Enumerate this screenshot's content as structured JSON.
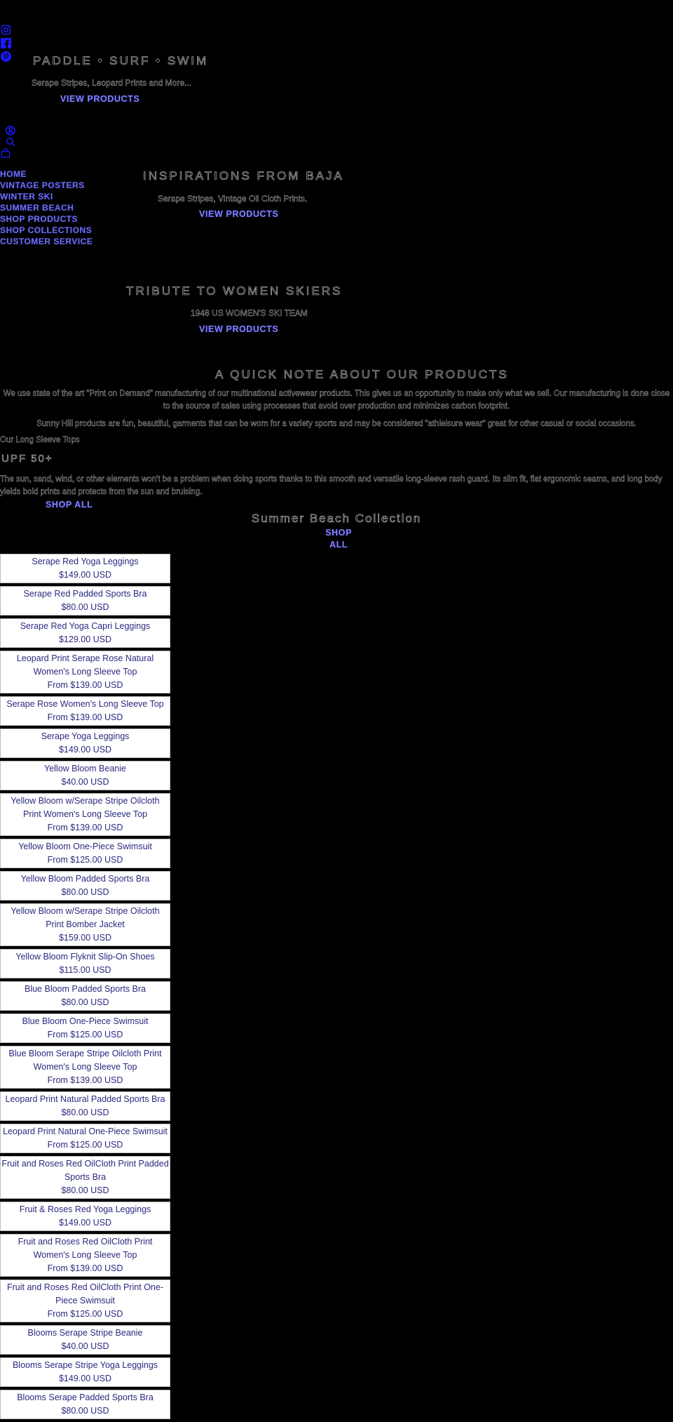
{
  "social": [
    {
      "name": "instagram-icon"
    },
    {
      "name": "facebook-icon"
    },
    {
      "name": "pinterest-icon"
    }
  ],
  "hero": [
    {
      "title": "PADDLE • SURF • SWIM",
      "subtitle": "Serape Stripes, Leopard Prints and More...",
      "cta": "VIEW PRODUCTS"
    },
    {
      "title": "INSPIRATIONS FROM BAJA",
      "subtitle": "Serape Stripes, Vintage Oil Cloth Prints.",
      "cta": "VIEW PRODUCTS"
    },
    {
      "title": "TRIBUTE TO WOMEN SKIERS",
      "subtitle": "1948 US WOMEN'S SKI TEAM",
      "cta": "VIEW PRODUCTS"
    }
  ],
  "header_icons": [
    {
      "name": "account-icon"
    },
    {
      "name": "search-icon"
    },
    {
      "name": "cart-icon"
    }
  ],
  "nav": [
    "HOME",
    "VINTAGE POSTERS",
    "WINTER SKI",
    "SUMMER BEACH",
    "SHOP PRODUCTS",
    "SHOP COLLECTIONS",
    "CUSTOMER SERVICE"
  ],
  "about": {
    "heading": "A QUICK NOTE ABOUT OUR PRODUCTS",
    "p1": "We use state of the art \"Print on Demand\" manufacturing of our multinational activewear products. This gives us an opportunity to make only what we sell. Our manufacturing is done close to the source of sales using processes that avoid over production and minimizes carbon footprint.",
    "p2": "Sunny Hill products are fun, beautiful, garments that can be worn for a variety sports and may be considered \"athleisure wear\" great for other casual or social occasions."
  },
  "featured": {
    "label": "Our Long Sleeve Tops",
    "heading": "UPF 50+",
    "body": "The sun, sand, wind, or other elements won't be a problem when doing sports thanks to this smooth and versatile long-sleeve rash guard. Its slim fit, flat ergonomic seams, and long body yields bold prints and protects from the sun and bruising.",
    "cta": "SHOP ALL"
  },
  "collection": {
    "title": "Summer Beach Collection",
    "cta_line1": "SHOP",
    "cta_line2": "ALL"
  },
  "products": [
    {
      "title": "Serape Red Yoga Leggings",
      "price": "$149.00 USD"
    },
    {
      "title": "Serape Red Padded Sports Bra",
      "price": "$80.00 USD"
    },
    {
      "title": "Serape Red Yoga Capri Leggings",
      "price": "$129.00 USD"
    },
    {
      "title": "Leopard Print Serape Rose Natural Women's Long Sleeve Top",
      "price": "From $139.00 USD"
    },
    {
      "title": "Serape Rose Women's Long Sleeve Top",
      "price": "From $139.00 USD"
    },
    {
      "title": "Serape Yoga Leggings",
      "price": "$149.00 USD"
    },
    {
      "title": "Yellow Bloom Beanie",
      "price": "$40.00 USD"
    },
    {
      "title": "Yellow Bloom w/Serape Stripe Oilcloth Print Women's Long Sleeve Top",
      "price": "From $139.00 USD"
    },
    {
      "title": "Yellow Bloom One-Piece Swimsuit",
      "price": "From $125.00 USD"
    },
    {
      "title": "Yellow Bloom Padded Sports Bra",
      "price": "$80.00 USD"
    },
    {
      "title": "Yellow Bloom w/Serape Stripe Oilcloth Print Bomber Jacket",
      "price": "$159.00 USD"
    },
    {
      "title": "Yellow Bloom Flyknit Slip-On Shoes",
      "price": "$115.00 USD"
    },
    {
      "title": "Blue Bloom Padded Sports Bra",
      "price": "$80.00 USD"
    },
    {
      "title": "Blue Bloom One-Piece Swimsuit",
      "price": "From $125.00 USD"
    },
    {
      "title": "Blue Bloom Serape Stripe Oilcloth Print Women's Long Sleeve Top",
      "price": "From $139.00 USD"
    },
    {
      "title": "Leopard Print Natural Padded Sports Bra",
      "price": "$80.00 USD"
    },
    {
      "title": "Leopard Print Natural One-Piece Swimsuit",
      "price": "From $125.00 USD"
    },
    {
      "title": "Fruit and Roses Red OilCloth Print Padded Sports Bra",
      "price": "$80.00 USD"
    },
    {
      "title": "Fruit & Roses Red Yoga Leggings",
      "price": "$149.00 USD"
    },
    {
      "title": "Fruit and Roses Red OilCloth Print Women's Long Sleeve Top",
      "price": "From $139.00 USD"
    },
    {
      "title": "Fruit and Roses Red OilCloth Print One-Piece Swimsuit",
      "price": "From $125.00 USD"
    },
    {
      "title": "Blooms Serape Stripe Beanie",
      "price": "$40.00 USD"
    },
    {
      "title": "Blooms Serape Stripe Yoga Leggings",
      "price": "$149.00 USD"
    },
    {
      "title": "Blooms Serape Padded Sports Bra",
      "price": "$80.00 USD"
    }
  ]
}
